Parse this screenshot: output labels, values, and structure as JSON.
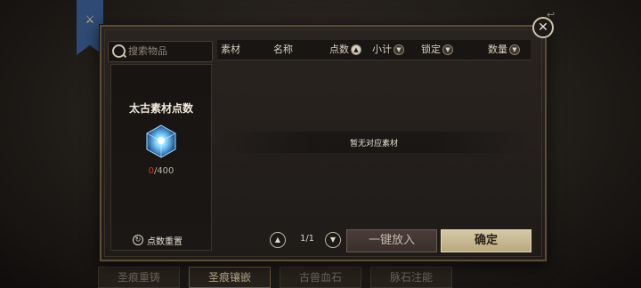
{
  "search": {
    "placeholder": "搜索物品"
  },
  "left": {
    "title": "太古素材点数",
    "current": "0",
    "max": "/400",
    "reset_label": "点数重置"
  },
  "table": {
    "columns": [
      {
        "label": "素材"
      },
      {
        "label": "名称"
      },
      {
        "label": "点数",
        "sort": "up-active"
      },
      {
        "label": "小计",
        "sort": "down"
      },
      {
        "label": "锁定",
        "sort": "down"
      },
      {
        "label": "数量",
        "sort": "down"
      }
    ],
    "empty_text": "暂无对应素材"
  },
  "pager": {
    "label": "1/1"
  },
  "actions": {
    "put_in": "一键放入",
    "confirm": "确定"
  },
  "bg_tabs": [
    "圣痕重铸",
    "圣痕镶嵌",
    "古兽血石",
    "脉石注能"
  ],
  "colors": {
    "accent": "#d5c8a7",
    "points_current": "#d23a2a",
    "banner": "#2f4a74"
  }
}
